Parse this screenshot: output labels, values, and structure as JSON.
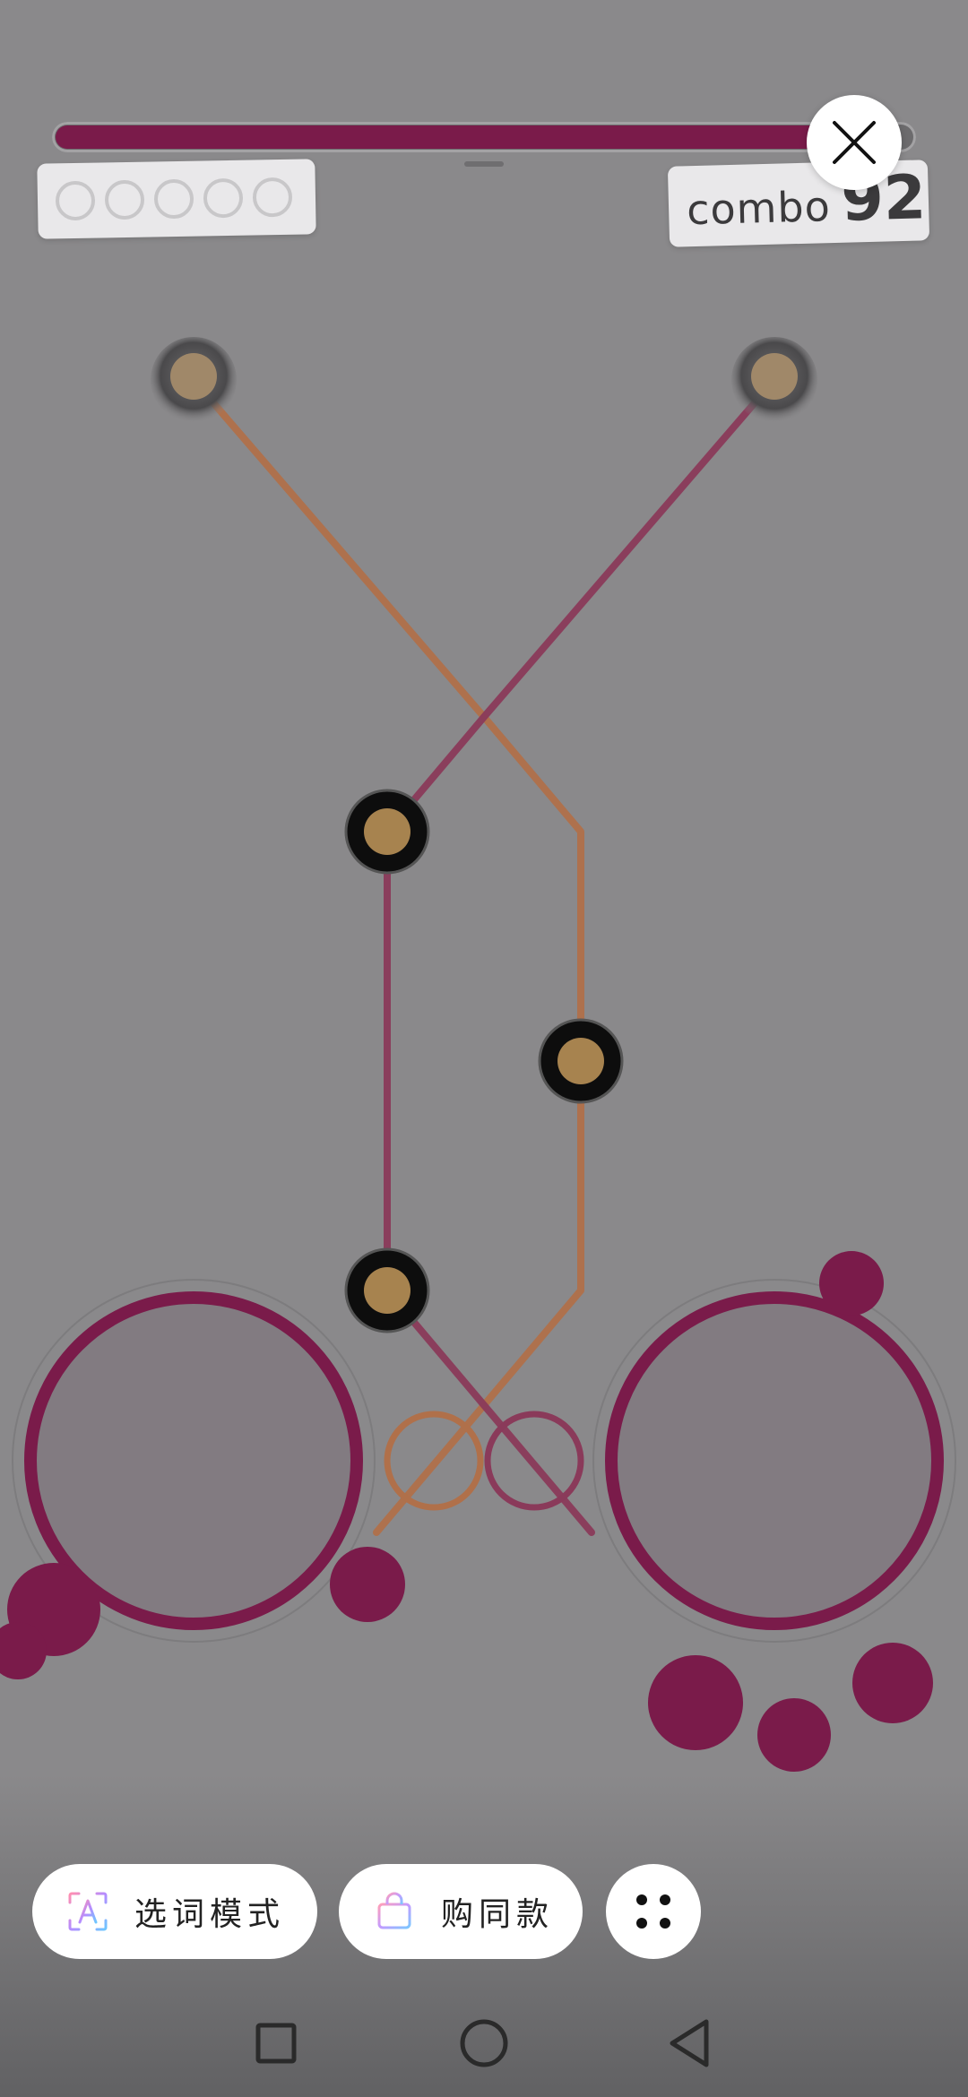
{
  "game": {
    "health_fraction": 0.95,
    "lives_total": 5,
    "combo_label": "combo",
    "combo_value": "92",
    "colors": {
      "background": "#8a898b",
      "magenta": "#7a1b4a",
      "orange_track": "#b0704a",
      "magenta_track": "#8a3a5a",
      "node_fill": "#a7834f"
    }
  },
  "toolbar": {
    "select_words_label": "选词模式",
    "buy_same_label": "购同款"
  },
  "icons": {
    "close": "close-icon",
    "select_words": "text-select-icon",
    "buy_same": "shopping-bag-icon",
    "more": "grid-dots-icon",
    "nav_recent": "square-icon",
    "nav_home": "circle-icon",
    "nav_back": "back-triangle-icon"
  }
}
